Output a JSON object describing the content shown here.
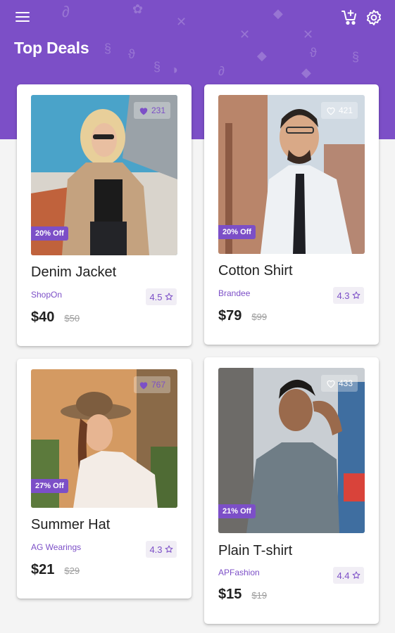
{
  "header": {
    "title": "Top Deals",
    "menu_icon": "menu-icon",
    "cart_icon": "add-shopping-cart-icon",
    "settings_icon": "settings-gear-icon",
    "background": "#7c4fc7"
  },
  "colors": {
    "accent": "#7c4fc7",
    "text": "#212121",
    "muted": "#9e9e9e",
    "page_background": "#f4f4f4"
  },
  "products": [
    {
      "name": "Denim Jacket",
      "brand": "ShopOn",
      "price": "$40",
      "old_price": "$50",
      "discount": "20% Off",
      "likes": "231",
      "liked": true,
      "rating": "4.5"
    },
    {
      "name": "Cotton Shirt",
      "brand": "Brandee",
      "price": "$79",
      "old_price": "$99",
      "discount": "20% Off",
      "likes": "421",
      "liked": false,
      "rating": "4.3"
    },
    {
      "name": "Summer Hat",
      "brand": "AG Wearings",
      "price": "$21",
      "old_price": "$29",
      "discount": "27% Off",
      "likes": "767",
      "liked": true,
      "rating": "4.3"
    },
    {
      "name": "Plain T-shirt",
      "brand": "APFashion",
      "price": "$15",
      "old_price": "$19",
      "discount": "21% Off",
      "likes": "433",
      "liked": false,
      "rating": "4.4"
    }
  ]
}
